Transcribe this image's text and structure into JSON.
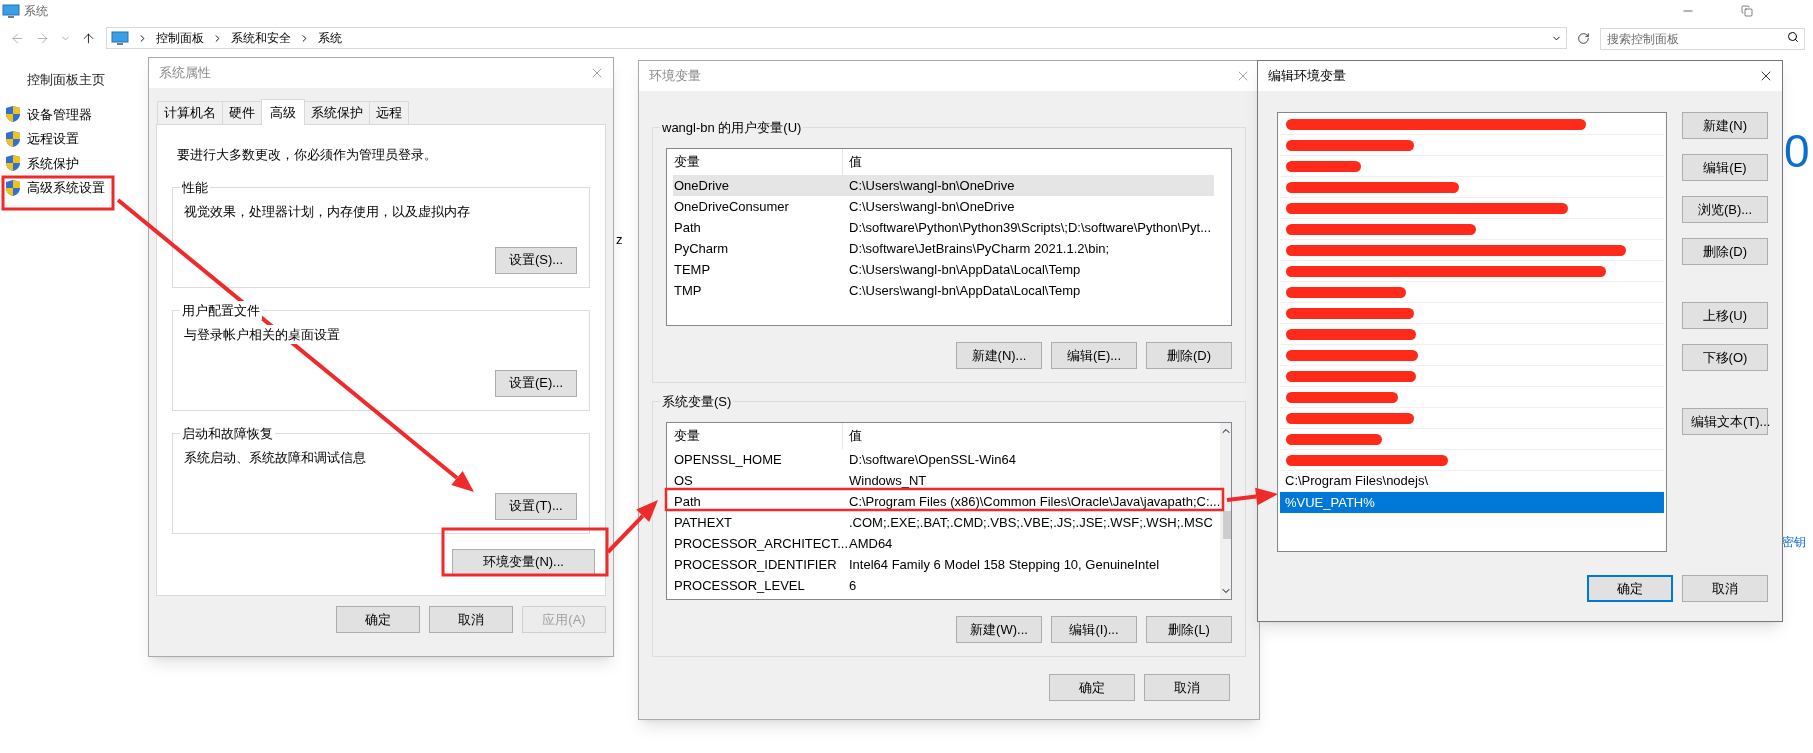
{
  "window": {
    "title": "系统",
    "breadcrumb": [
      "控制面板",
      "系统和安全",
      "系统"
    ],
    "search": {
      "placeholder": "搜索控制面板"
    }
  },
  "sidebar": {
    "home": "控制面板主页",
    "items": [
      {
        "label": "设备管理器"
      },
      {
        "label": "远程设置"
      },
      {
        "label": "系统保护"
      },
      {
        "label": "高级系统设置"
      }
    ]
  },
  "background": {
    "fragment_1": "z",
    "fragment_2": "0",
    "fragment_3": "密钥"
  },
  "system_properties": {
    "title": "系统属性",
    "tabs": [
      {
        "label": "计算机名",
        "selected": false
      },
      {
        "label": "硬件",
        "selected": false
      },
      {
        "label": "高级",
        "selected": true
      },
      {
        "label": "系统保护",
        "selected": false
      },
      {
        "label": "远程",
        "selected": false
      }
    ],
    "notice": "要进行大多数更改，你必须作为管理员登录。",
    "groups": [
      {
        "title": "性能",
        "description": "视觉效果，处理器计划，内存使用，以及虚拟内存",
        "button": "设置(S)..."
      },
      {
        "title": "用户配置文件",
        "description": "与登录帐户相关的桌面设置",
        "button": "设置(E)..."
      },
      {
        "title": "启动和故障恢复",
        "description": "系统启动、系统故障和调试信息",
        "button": "设置(T)..."
      }
    ],
    "env_button": "环境变量(N)...",
    "buttons": [
      {
        "label": "确定",
        "disabled": false
      },
      {
        "label": "取消",
        "disabled": false
      },
      {
        "label": "应用(A)",
        "disabled": true
      }
    ]
  },
  "environment_variables": {
    "title": "环境变量",
    "user_section": {
      "title": "wangl-bn 的用户变量(U)",
      "columns": [
        "变量",
        "值"
      ],
      "rows": [
        {
          "name": "OneDrive",
          "value": "C:\\Users\\wangl-bn\\OneDrive",
          "selected": true
        },
        {
          "name": "OneDriveConsumer",
          "value": "C:\\Users\\wangl-bn\\OneDrive",
          "selected": false
        },
        {
          "name": "Path",
          "value": "D:\\software\\Python\\Python39\\Scripts\\;D:\\software\\Python\\Pyt...",
          "selected": false
        },
        {
          "name": "PyCharm",
          "value": "D:\\software\\JetBrains\\PyCharm 2021.1.2\\bin;",
          "selected": false
        },
        {
          "name": "TEMP",
          "value": "C:\\Users\\wangl-bn\\AppData\\Local\\Temp",
          "selected": false
        },
        {
          "name": "TMP",
          "value": "C:\\Users\\wangl-bn\\AppData\\Local\\Temp",
          "selected": false
        }
      ],
      "buttons": [
        "新建(N)...",
        "编辑(E)...",
        "删除(D)"
      ]
    },
    "system_section": {
      "title": "系统变量(S)",
      "columns": [
        "变量",
        "值"
      ],
      "rows": [
        {
          "name": "OPENSSL_HOME",
          "value": "D:\\software\\OpenSSL-Win64",
          "selected": false
        },
        {
          "name": "OS",
          "value": "Windows_NT",
          "selected": false
        },
        {
          "name": "Path",
          "value": "C:\\Program Files (x86)\\Common Files\\Oracle\\Java\\javapath;C:...",
          "selected": false
        },
        {
          "name": "PATHEXT",
          "value": ".COM;.EXE;.BAT;.CMD;.VBS;.VBE;.JS;.JSE;.WSF;.WSH;.MSC",
          "selected": false
        },
        {
          "name": "PROCESSOR_ARCHITECT...",
          "value": "AMD64",
          "selected": false
        },
        {
          "name": "PROCESSOR_IDENTIFIER",
          "value": "Intel64 Family 6 Model 158 Stepping 10, GenuineIntel",
          "selected": false
        },
        {
          "name": "PROCESSOR_LEVEL",
          "value": "6",
          "selected": false
        }
      ],
      "buttons": [
        "新建(W)...",
        "编辑(I)...",
        "删除(L)"
      ]
    },
    "buttons": [
      "确定",
      "取消"
    ]
  },
  "edit_variable": {
    "title": "编辑环境变量",
    "entries": [
      {
        "kind": "redacted"
      },
      {
        "kind": "redacted"
      },
      {
        "kind": "redacted"
      },
      {
        "kind": "redacted"
      },
      {
        "kind": "redacted"
      },
      {
        "kind": "redacted"
      },
      {
        "kind": "redacted"
      },
      {
        "kind": "redacted"
      },
      {
        "kind": "redacted"
      },
      {
        "kind": "redacted"
      },
      {
        "kind": "redacted"
      },
      {
        "kind": "redacted"
      },
      {
        "kind": "redacted"
      },
      {
        "kind": "redacted"
      },
      {
        "kind": "redacted"
      },
      {
        "kind": "redacted"
      },
      {
        "kind": "redacted"
      },
      {
        "kind": "text",
        "text": "C:\\Program Files\\nodejs\\",
        "selected": false
      },
      {
        "kind": "text",
        "text": "%VUE_PATH%",
        "selected": true
      }
    ],
    "side_button_groups": [
      [
        "新建(N)",
        "编辑(E)",
        "浏览(B)...",
        "删除(D)"
      ],
      [
        "上移(U)",
        "下移(O)"
      ],
      [
        "编辑文本(T)..."
      ]
    ],
    "buttons": [
      {
        "label": "确定",
        "default": true
      },
      {
        "label": "取消",
        "default": false
      }
    ]
  }
}
